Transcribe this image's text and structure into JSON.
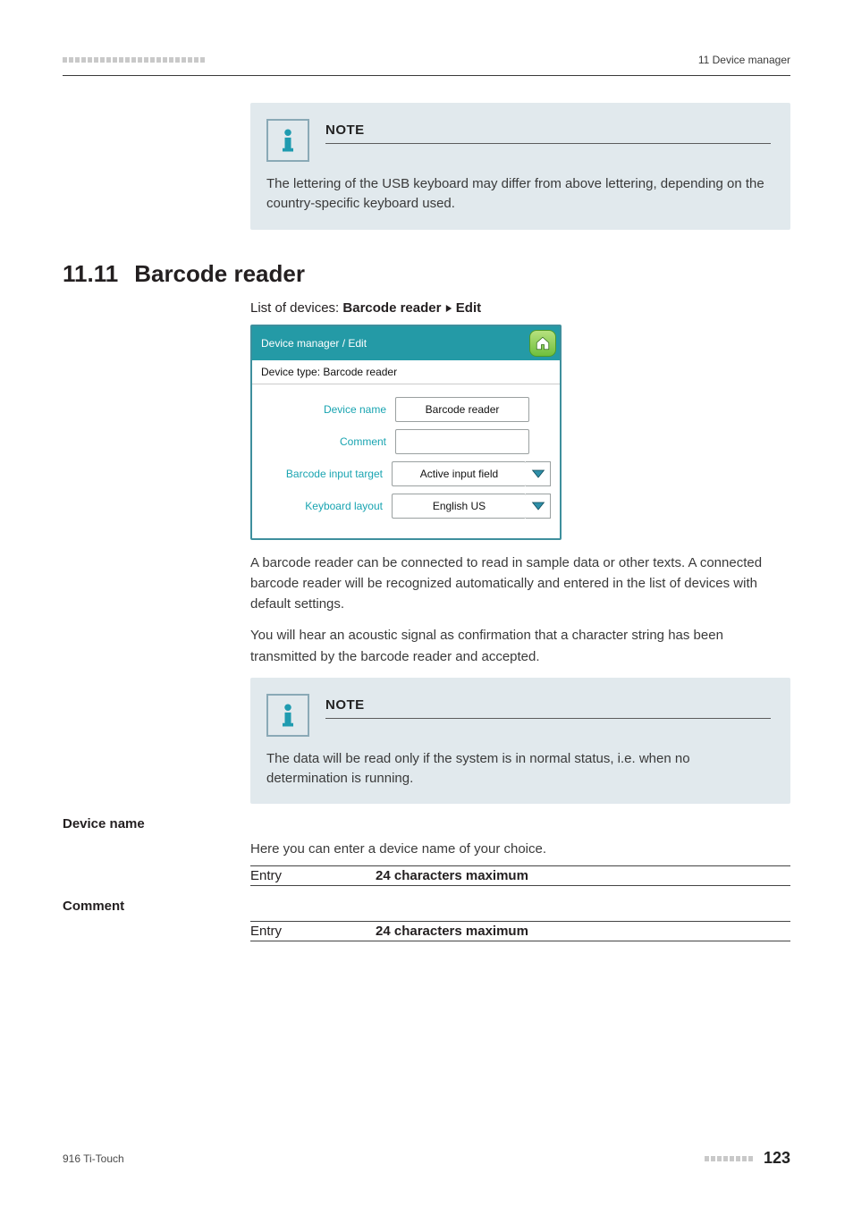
{
  "header": {
    "right_text": "11 Device manager"
  },
  "note1": {
    "title": "NOTE",
    "body": "The lettering of the USB keyboard may differ from above lettering, depending on the country-specific keyboard used."
  },
  "section": {
    "number": "11.11",
    "title": "Barcode reader"
  },
  "intro": {
    "prefix": "List of devices: ",
    "bold1": "Barcode reader",
    "bold2": "Edit"
  },
  "ui": {
    "titlebar": "Device manager / Edit",
    "subtitle": "Device type: Barcode reader",
    "rows": {
      "device_name": {
        "label": "Device name",
        "value": "Barcode reader"
      },
      "comment": {
        "label": "Comment",
        "value": ""
      },
      "input_target": {
        "label": "Barcode input target",
        "value": "Active input field"
      },
      "keyboard_layout": {
        "label": "Keyboard layout",
        "value": "English US"
      }
    },
    "home_icon_name": "home-icon",
    "dropdown_icon_name": "chevron-down-icon"
  },
  "para1": "A barcode reader can be connected to read in sample data or other texts. A connected barcode reader will be recognized automatically and entered in the list of devices with default settings.",
  "para2": "You will hear an acoustic signal as confirmation that a character string has been transmitted by the barcode reader and accepted.",
  "note2": {
    "title": "NOTE",
    "body": "The data will be read only if the system is in normal status, i.e. when no determination is running."
  },
  "fields": {
    "device_name": {
      "heading": "Device name",
      "desc": "Here you can enter a device name of your choice.",
      "entry_label": "Entry",
      "entry_value": "24 characters maximum"
    },
    "comment": {
      "heading": "Comment",
      "entry_label": "Entry",
      "entry_value": "24 characters maximum"
    }
  },
  "footer": {
    "left": "916 Ti-Touch",
    "page": "123"
  },
  "icons": {
    "info_icon_name": "info-icon"
  }
}
